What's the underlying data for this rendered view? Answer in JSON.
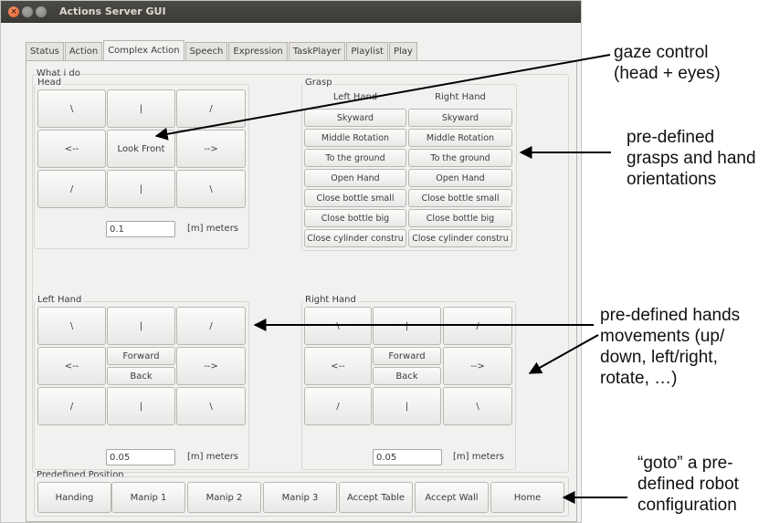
{
  "window": {
    "title": "Actions Server GUI",
    "close_glyph": "×"
  },
  "tabs": [
    "Status",
    "Action",
    "Complex Action",
    "Speech",
    "Expression",
    "TaskPlayer",
    "Playlist",
    "Play"
  ],
  "active_tab": "Complex Action",
  "what_i_do_label": "What i do",
  "head": {
    "label": "Head",
    "grid": [
      "\\",
      "|",
      "/",
      "<--",
      "Look Front",
      "-->",
      "/",
      "|",
      "\\"
    ],
    "value": "0.1",
    "unit": "[m] meters"
  },
  "grasp": {
    "label": "Grasp",
    "left_header": "Left Hand",
    "right_header": "Right Hand",
    "rows": [
      "Skyward",
      "Middle Rotation",
      "To the ground",
      "Open Hand",
      "Close bottle small",
      "Close bottle big",
      "Close cylinder constru"
    ]
  },
  "left_hand": {
    "label": "Left Hand",
    "top": [
      "\\",
      "|",
      "/"
    ],
    "left": "<--",
    "forward": "Forward",
    "back": "Back",
    "right": "-->",
    "bottom": [
      "/",
      "|",
      "\\"
    ],
    "value": "0.05",
    "unit": "[m] meters"
  },
  "right_hand": {
    "label": "Right Hand",
    "top": [
      "\\",
      "|",
      "/"
    ],
    "left": "<--",
    "forward": "Forward",
    "back": "Back",
    "right": "-->",
    "bottom": [
      "/",
      "|",
      "\\"
    ],
    "value": "0.05",
    "unit": "[m] meters"
  },
  "predefined": {
    "label": "Predefined Position",
    "buttons": [
      "Handing",
      "Manip 1",
      "Manip 2",
      "Manip 3",
      "Accept Table",
      "Accept Wall",
      "Home"
    ]
  },
  "annotations": {
    "gaze": [
      "gaze control",
      "(head + eyes)"
    ],
    "grasps": [
      "pre-defined",
      "grasps and hand",
      "orientations"
    ],
    "hands": [
      "pre-defined hands",
      "movements (up/",
      "down, left/right,",
      "rotate, …)"
    ],
    "goto": [
      "“goto” a pre-",
      "defined robot",
      "configuration"
    ]
  }
}
